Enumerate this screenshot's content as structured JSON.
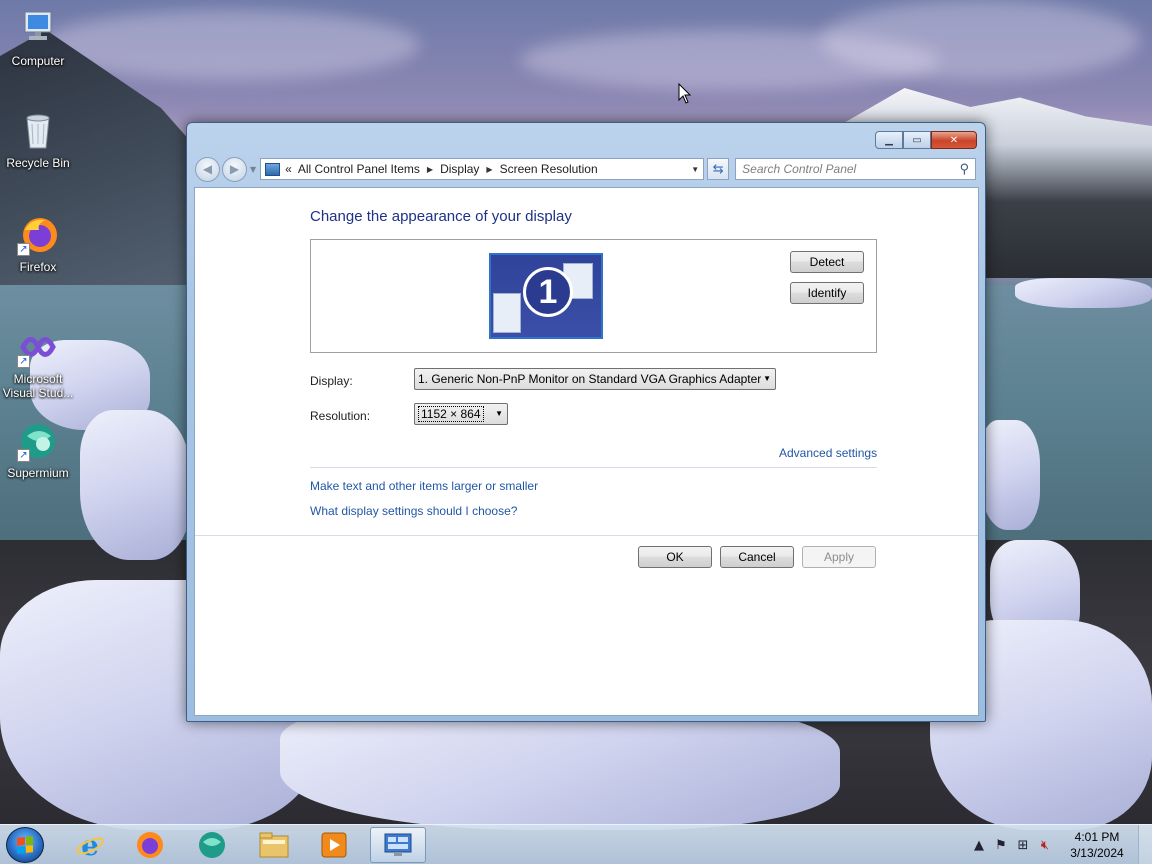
{
  "desktop": {
    "icons": [
      {
        "label": "Computer"
      },
      {
        "label": "Recycle Bin"
      },
      {
        "label": "Firefox"
      },
      {
        "label": "Microsoft Visual Stud..."
      },
      {
        "label": "Supermium"
      }
    ]
  },
  "window": {
    "address": {
      "crumbs": [
        "All Control Panel Items",
        "Display",
        "Screen Resolution"
      ],
      "prefix": "«"
    },
    "search": {
      "placeholder": "Search Control Panel"
    },
    "heading": "Change the appearance of your display",
    "monitor_number": "1",
    "detect_label": "Detect",
    "identify_label": "Identify",
    "display_label": "Display:",
    "display_value": "1. Generic Non-PnP Monitor on Standard VGA Graphics Adapter",
    "resolution_label": "Resolution:",
    "resolution_value": "1152 × 864",
    "advanced_link": "Advanced settings",
    "link_text_size": "Make text and other items larger or smaller",
    "link_help": "What display settings should I choose?",
    "ok_label": "OK",
    "cancel_label": "Cancel",
    "apply_label": "Apply"
  },
  "taskbar": {
    "apps": [
      "start-button",
      "internet-explorer",
      "firefox",
      "supermium",
      "file-explorer",
      "media-player",
      "control-panel"
    ],
    "clock": {
      "time": "4:01 PM",
      "date": "3/13/2024"
    }
  },
  "colors": {
    "heading": "#1e3287",
    "link": "#2257a6",
    "monitor_bg": "#3b4fa8",
    "close_button": "#c8452a"
  }
}
